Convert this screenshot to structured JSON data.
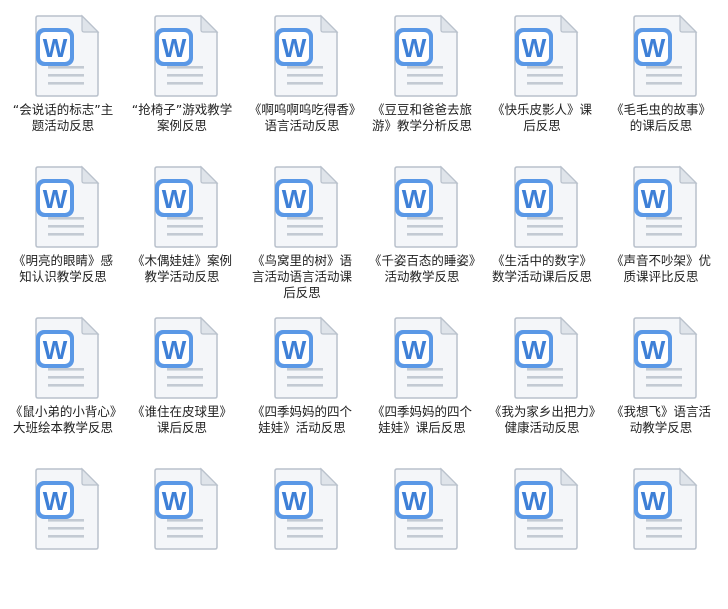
{
  "theme": {
    "icon_blue": "#3d7fd6",
    "icon_blue_light": "#5a98e6",
    "page_fill": "#f4f6f9",
    "page_stroke": "#b9c1cc",
    "fold_fill": "#dfe4ea",
    "line_color": "#c3cad3"
  },
  "icon": {
    "name": "word-document-icon",
    "letter": "W"
  },
  "files": [
    {
      "name": "“会说话的标志”主题活动反思"
    },
    {
      "name": "“抢椅子”游戏教学案例反思"
    },
    {
      "name": "《啊呜啊呜吃得香》语言活动反思"
    },
    {
      "name": "《豆豆和爸爸去旅游》教学分析反思"
    },
    {
      "name": "《快乐皮影人》课后反思"
    },
    {
      "name": "《毛毛虫的故事》的课后反思"
    },
    {
      "name": "《明亮的眼睛》感知认识教学反思"
    },
    {
      "name": "《木偶娃娃》案例教学活动反思"
    },
    {
      "name": "《鸟窝里的树》语言活动语言活动课后反思"
    },
    {
      "name": "《千姿百态的睡姿》活动教学反思"
    },
    {
      "name": "《生活中的数字》数学活动课后反思"
    },
    {
      "name": "《声音不吵架》优质课评比反思"
    },
    {
      "name": "《鼠小弟的小背心》大班绘本教学反思"
    },
    {
      "name": "《谁住在皮球里》课后反思"
    },
    {
      "name": "《四季妈妈的四个娃娃》活动反思"
    },
    {
      "name": "《四季妈妈的四个娃娃》课后反思"
    },
    {
      "name": "《我为家乡出把力》健康活动反思"
    },
    {
      "name": "《我想飞》语言活动教学反思"
    },
    {
      "name": ""
    },
    {
      "name": ""
    },
    {
      "name": ""
    },
    {
      "name": ""
    },
    {
      "name": ""
    },
    {
      "name": ""
    }
  ]
}
